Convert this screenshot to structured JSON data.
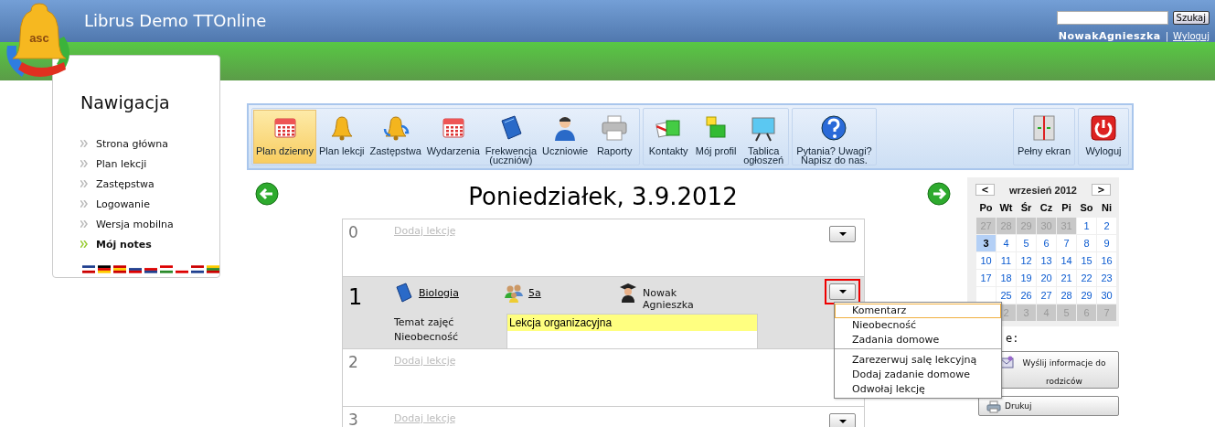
{
  "header": {
    "logo_text": "asc",
    "title": "Librus Demo TTOnline",
    "search": {
      "button": "Szukaj"
    },
    "user": "NowakAgnieszka",
    "separator": "|",
    "logout": "Wyloguj"
  },
  "navigation": {
    "title": "Nawigacja",
    "items": [
      {
        "label": "Strona główna",
        "selected": false
      },
      {
        "label": "Plan lekcji",
        "selected": false
      },
      {
        "label": "Zastępstwa",
        "selected": false
      },
      {
        "label": "Logowanie",
        "selected": false
      },
      {
        "label": "Wersja mobilna",
        "selected": false
      },
      {
        "label": "Mój notes",
        "selected": true
      }
    ]
  },
  "toolbar": {
    "groups": [
      {
        "items": [
          {
            "label": "Plan dzienny",
            "selected": true
          },
          {
            "label": "Plan lekcji",
            "selected": false
          },
          {
            "label": "Zastępstwa",
            "selected": false
          },
          {
            "label": "Wydarzenia",
            "selected": false
          },
          {
            "label": "Frekwencja\n(uczniów)",
            "selected": false
          },
          {
            "label": "Uczniowie",
            "selected": false
          },
          {
            "label": "Raporty",
            "selected": false
          }
        ]
      },
      {
        "items": [
          {
            "label": "Kontakty",
            "selected": false
          },
          {
            "label": "Mój profil",
            "selected": false
          },
          {
            "label": "Tablica\nogłoszeń",
            "selected": false
          }
        ]
      },
      {
        "items": [
          {
            "label": "Pytania? Uwagi?\nNapisz do nas.",
            "selected": false
          }
        ]
      },
      {
        "items": [
          {
            "label": "Pełny ekran",
            "selected": false
          }
        ]
      },
      {
        "items": [
          {
            "label": "Wyloguj",
            "selected": false
          }
        ]
      }
    ]
  },
  "day_title": "Poniedziałek, 3.9.2012",
  "lessons": [
    {
      "kind": "empty",
      "number": "0",
      "add_link": "Dodaj lekcję",
      "menu_button": true,
      "selected": false
    },
    {
      "kind": "lesson",
      "number": "1",
      "subject": "Biologia",
      "class": "5a",
      "teacher": "Nowak Agnieszka",
      "topic_label": "Temat zajęć",
      "topic": "Lekcja organizacyjna",
      "absence_label": "Nieobecność",
      "menu_button": true,
      "menu_open": true,
      "selected": true
    },
    {
      "kind": "empty",
      "number": "2",
      "add_link": "Dodaj lekcję",
      "selected": false
    },
    {
      "kind": "empty",
      "number": "3",
      "add_link": "Dodaj lekcję",
      "menu_button": true,
      "selected": false
    }
  ],
  "context_menu": {
    "groups": [
      {
        "items": [
          {
            "label": "Komentarz",
            "selected": true
          },
          {
            "label": "Nieobecność",
            "selected": false
          },
          {
            "label": "Zadania domowe",
            "selected": false
          }
        ]
      },
      {
        "items": [
          {
            "label": "Zarezerwuj salę lekcyjną",
            "selected": false
          },
          {
            "label": "Dodaj zadanie domowe",
            "selected": false
          },
          {
            "label": "Odwołaj lekcję",
            "selected": false
          }
        ]
      }
    ]
  },
  "calendar": {
    "prev": "<",
    "month": "wrzesień 2012",
    "next": ">",
    "weekdays": [
      "Po",
      "Wt",
      "Śr",
      "Cz",
      "Pi",
      "So",
      "Ni"
    ],
    "weeks": [
      [
        {
          "text": "27",
          "muted": true,
          "selected": false
        },
        {
          "text": "28",
          "muted": true,
          "selected": false
        },
        {
          "text": "29",
          "muted": true,
          "selected": false
        },
        {
          "text": "30",
          "muted": true,
          "selected": false
        },
        {
          "text": "31",
          "muted": true,
          "selected": false
        },
        {
          "text": "1",
          "muted": false,
          "selected": false
        },
        {
          "text": "2",
          "muted": false,
          "selected": false
        }
      ],
      [
        {
          "text": "3",
          "muted": false,
          "selected": true
        },
        {
          "text": "4",
          "muted": false,
          "selected": false
        },
        {
          "text": "5",
          "muted": false,
          "selected": false
        },
        {
          "text": "6",
          "muted": false,
          "selected": false
        },
        {
          "text": "7",
          "muted": false,
          "selected": false
        },
        {
          "text": "8",
          "muted": false,
          "selected": false
        },
        {
          "text": "9",
          "muted": false,
          "selected": false
        }
      ],
      [
        {
          "text": "10",
          "muted": false,
          "selected": false
        },
        {
          "text": "11",
          "muted": false,
          "selected": false
        },
        {
          "text": "12",
          "muted": false,
          "selected": false
        },
        {
          "text": "13",
          "muted": false,
          "selected": false
        },
        {
          "text": "14",
          "muted": false,
          "selected": false
        },
        {
          "text": "15",
          "muted": false,
          "selected": false
        },
        {
          "text": "16",
          "muted": false,
          "selected": false
        }
      ],
      [
        {
          "text": "17",
          "muted": false,
          "selected": false
        },
        {
          "text": "18",
          "muted": false,
          "selected": false
        },
        {
          "text": "19",
          "muted": false,
          "selected": false
        },
        {
          "text": "20",
          "muted": false,
          "selected": false
        },
        {
          "text": "21",
          "muted": false,
          "selected": false
        },
        {
          "text": "22",
          "muted": false,
          "selected": false
        },
        {
          "text": "23",
          "muted": false,
          "selected": false
        }
      ],
      [
        {
          "muted": false
        },
        {
          "text": "25",
          "muted": false,
          "selected": false
        },
        {
          "text": "26",
          "muted": false,
          "selected": false
        },
        {
          "text": "27",
          "muted": false,
          "selected": false
        },
        {
          "text": "28",
          "muted": false,
          "selected": false
        },
        {
          "text": "29",
          "muted": false,
          "selected": false
        },
        {
          "text": "30",
          "muted": false,
          "selected": false
        }
      ],
      [
        {
          "text": "2",
          "muted": true,
          "selected": false
        },
        {
          "text": "3",
          "muted": true,
          "selected": false
        },
        {
          "text": "4",
          "muted": true,
          "selected": false
        },
        {
          "text": "5",
          "muted": true,
          "selected": false
        },
        {
          "text": "6",
          "muted": true,
          "selected": false
        },
        {
          "text": "7",
          "muted": true,
          "selected": false
        }
      ]
    ]
  },
  "actions": {
    "label": "e:",
    "buttons": [
      {
        "label": "Wyślij informacje do rodziców"
      },
      {
        "label": "Drukuj"
      }
    ]
  }
}
